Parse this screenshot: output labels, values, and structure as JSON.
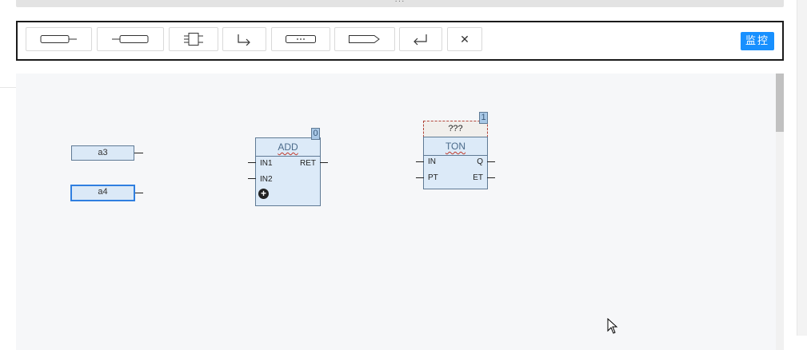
{
  "splitter": {
    "grip": "···"
  },
  "toolbar": {
    "buttons": [
      {
        "name": "output-variable-icon"
      },
      {
        "name": "input-variable-icon"
      },
      {
        "name": "function-block-icon"
      },
      {
        "name": "jump-icon"
      },
      {
        "name": "comment-icon"
      },
      {
        "name": "return-icon"
      },
      {
        "name": "enter-icon"
      },
      {
        "name": "close-icon",
        "label": "✕"
      }
    ],
    "monitor_label": "监控"
  },
  "canvas": {
    "variables": [
      {
        "label": "a3",
        "selected": false
      },
      {
        "label": "a4",
        "selected": true
      }
    ],
    "add_block": {
      "title": "ADD",
      "exec_order": "0",
      "inputs": [
        "IN1",
        "IN2"
      ],
      "outputs": [
        "RET"
      ],
      "add_pin": "+"
    },
    "ton_block": {
      "instance": "???",
      "title": "TON",
      "exec_order": "1",
      "inputs": [
        "IN",
        "PT"
      ],
      "outputs": [
        "Q",
        "ET"
      ]
    }
  },
  "colors": {
    "accent": "#1890ff",
    "block_fill": "#dceaf8",
    "block_border": "#5f7a95",
    "selection": "#2f7fe0",
    "canvas_bg": "#f6f7f9"
  }
}
